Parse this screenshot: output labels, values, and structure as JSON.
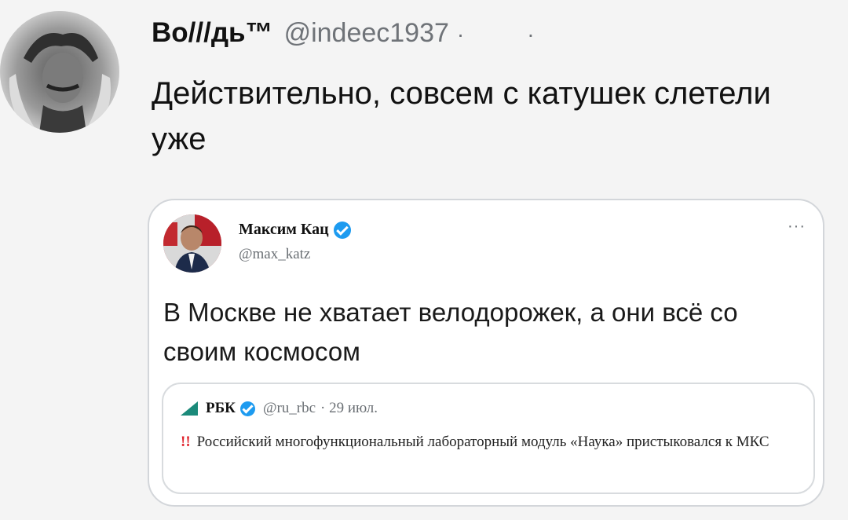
{
  "tweet": {
    "author_name": "Во///дь™",
    "author_handle": "@indeec1937",
    "separator": "·",
    "text": "Действительно, совсем с катушек слетели уже"
  },
  "quoted_tweet": {
    "author_name": "Максим Кац",
    "author_handle": "@max_katz",
    "more": "···",
    "text": "В Москве не хватает велодорожек, а они всё со своим космосом",
    "nested_quote": {
      "author_name": "РБК",
      "author_handle": "@ru_rbc",
      "date": "· 29 июл.",
      "alert": "!!",
      "text": "Российский многофункциональный лабораторный модуль «Наука» пристыковался к МКС"
    }
  },
  "colors": {
    "background": "#f4f4f4",
    "verified_badge": "#1d9bf0",
    "alert_red": "#e0222b",
    "secondary_text": "#6f7378"
  }
}
